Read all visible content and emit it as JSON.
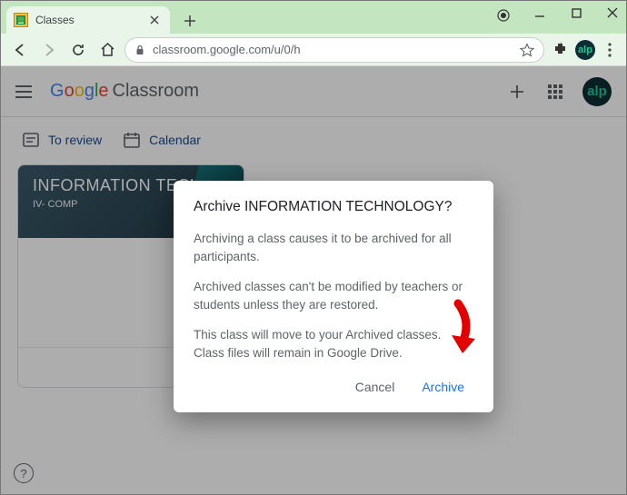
{
  "browser": {
    "tab_title": "Classes",
    "url": "classroom.google.com/u/0/h",
    "avatar_text": "alp"
  },
  "appbar": {
    "logo_word1_letters": [
      "G",
      "o",
      "o",
      "g",
      "l",
      "e"
    ],
    "logo_word2": "Classroom",
    "avatar_text": "alp"
  },
  "toolbar": {
    "review_label": "To review",
    "calendar_label": "Calendar"
  },
  "card": {
    "title": "INFORMATION TECHNOLOGY",
    "subtitle": "IV- COMP"
  },
  "dialog": {
    "title": "Archive INFORMATION TECHNOLOGY?",
    "p1": "Archiving a class causes it to be archived for all participants.",
    "p2": "Archived classes can't be modified by teachers or students unless they are restored.",
    "p3": "This class will move to your Archived classes. Class files will remain in Google Drive.",
    "cancel_label": "Cancel",
    "confirm_label": "Archive"
  },
  "help_label": "?"
}
